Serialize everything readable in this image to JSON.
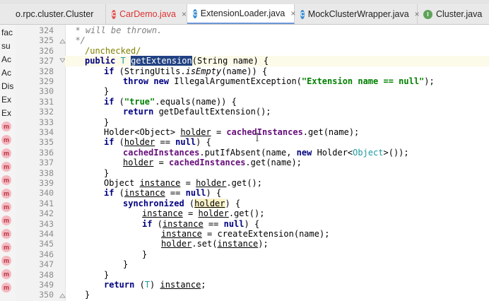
{
  "tabs": [
    {
      "label": "o.rpc.cluster.Cluster",
      "icon": "class-icon",
      "active": false,
      "closable": false
    },
    {
      "label": "CarDemo.java",
      "icon": "class-error-icon",
      "active": false,
      "closable": true
    },
    {
      "label": "ExtensionLoader.java",
      "icon": "class-icon",
      "active": true,
      "closable": true
    },
    {
      "label": "MockClusterWrapper.java",
      "icon": "class-icon",
      "active": false,
      "closable": true
    },
    {
      "label": "Cluster.java",
      "icon": "interface-icon",
      "active": false,
      "closable": false
    }
  ],
  "close_glyph": "×",
  "left_panel": {
    "text_items": [
      "fac",
      "su",
      "Ac",
      "Ac",
      "Dis",
      "Ex",
      "Ex"
    ],
    "method_marker": "m"
  },
  "lines": [
    {
      "num": "324"
    },
    {
      "num": "325"
    },
    {
      "num": "326"
    },
    {
      "num": "327"
    },
    {
      "num": "328"
    },
    {
      "num": "329"
    },
    {
      "num": "330"
    },
    {
      "num": "331"
    },
    {
      "num": "332"
    },
    {
      "num": "333"
    },
    {
      "num": "334"
    },
    {
      "num": "335"
    },
    {
      "num": "336"
    },
    {
      "num": "337"
    },
    {
      "num": "338"
    },
    {
      "num": "339"
    },
    {
      "num": "340"
    },
    {
      "num": "341"
    },
    {
      "num": "342"
    },
    {
      "num": "343"
    },
    {
      "num": "344"
    },
    {
      "num": "345"
    },
    {
      "num": "346"
    },
    {
      "num": "347"
    },
    {
      "num": "348"
    },
    {
      "num": "349"
    },
    {
      "num": "350"
    }
  ],
  "code": {
    "l324": "  * will be thrown.",
    "l325": "  */",
    "l326": "/unchecked/",
    "l327": {
      "public": "public",
      "T": "T",
      "method": "getExtension",
      "rest": "(String name) {"
    },
    "l328": {
      "kw": "if",
      "a": " (StringUtils.",
      "m": "isEmpty",
      "b": "(name)) {"
    },
    "l329": {
      "kw1": "throw",
      "kw2": "new",
      "a": " IllegalArgumentException(",
      "str": "\"Extension name == null\"",
      "b": ");"
    },
    "l330": "}",
    "l331": {
      "kw": "if",
      "a": " (",
      "str": "\"true\"",
      "b": ".equals(name)) {"
    },
    "l332": {
      "kw": "return",
      "a": " getDefaultExtension();"
    },
    "l333": "}",
    "l334": {
      "a": "Holder<Object> ",
      "var": "holder",
      "b": " = ",
      "fld1": "cachedIn",
      "fld2": "stances",
      "c": ".get(name);"
    },
    "l335": {
      "kw": "if",
      "a": " (",
      "var": "holder",
      "b": " == ",
      "kw2": "null",
      "c": ") {"
    },
    "l336": {
      "fld": "cachedInstances",
      "a": ".putIfAbsent(name, ",
      "kw": "new",
      "b": " Holder<",
      "typ": "Object",
      "c": ">());"
    },
    "l337": {
      "var": "holder",
      "a": " = ",
      "fld": "cachedInstances",
      "b": ".get(name);"
    },
    "l338": "}",
    "l339": {
      "a": "Object ",
      "var": "instance",
      "b": " = ",
      "var2": "holder",
      "c": ".get();"
    },
    "l340": {
      "kw": "if",
      "a": " (",
      "var": "instance",
      "b": " == ",
      "kw2": "null",
      "c": ") {"
    },
    "l341": {
      "kw": "synchronized",
      "a": " (",
      "var": "holder",
      "b": ") {"
    },
    "l342": {
      "var": "instance",
      "a": " = ",
      "var2": "holder",
      "b": ".get();"
    },
    "l343": {
      "kw": "if",
      "a": " (",
      "var": "instance",
      "b": " == ",
      "kw2": "null",
      "c": ") {"
    },
    "l344": {
      "var": "instance",
      "a": " = createExtension(name);"
    },
    "l345": {
      "var": "holder",
      "a": ".set(",
      "var2": "instance",
      "b": ");"
    },
    "l346": "}",
    "l347": "}",
    "l348": "}",
    "l349": {
      "kw": "return",
      "a": " (",
      "typ": "T",
      "b": ") ",
      "var": "instance",
      "c": ";"
    },
    "l350": "}"
  },
  "colors": {
    "keyword": "#000080",
    "string": "#008000",
    "field": "#660e7a",
    "annotation": "#808000",
    "comment": "#808080",
    "selection": "#214283",
    "tab_active_underline": "#6d95d8"
  }
}
